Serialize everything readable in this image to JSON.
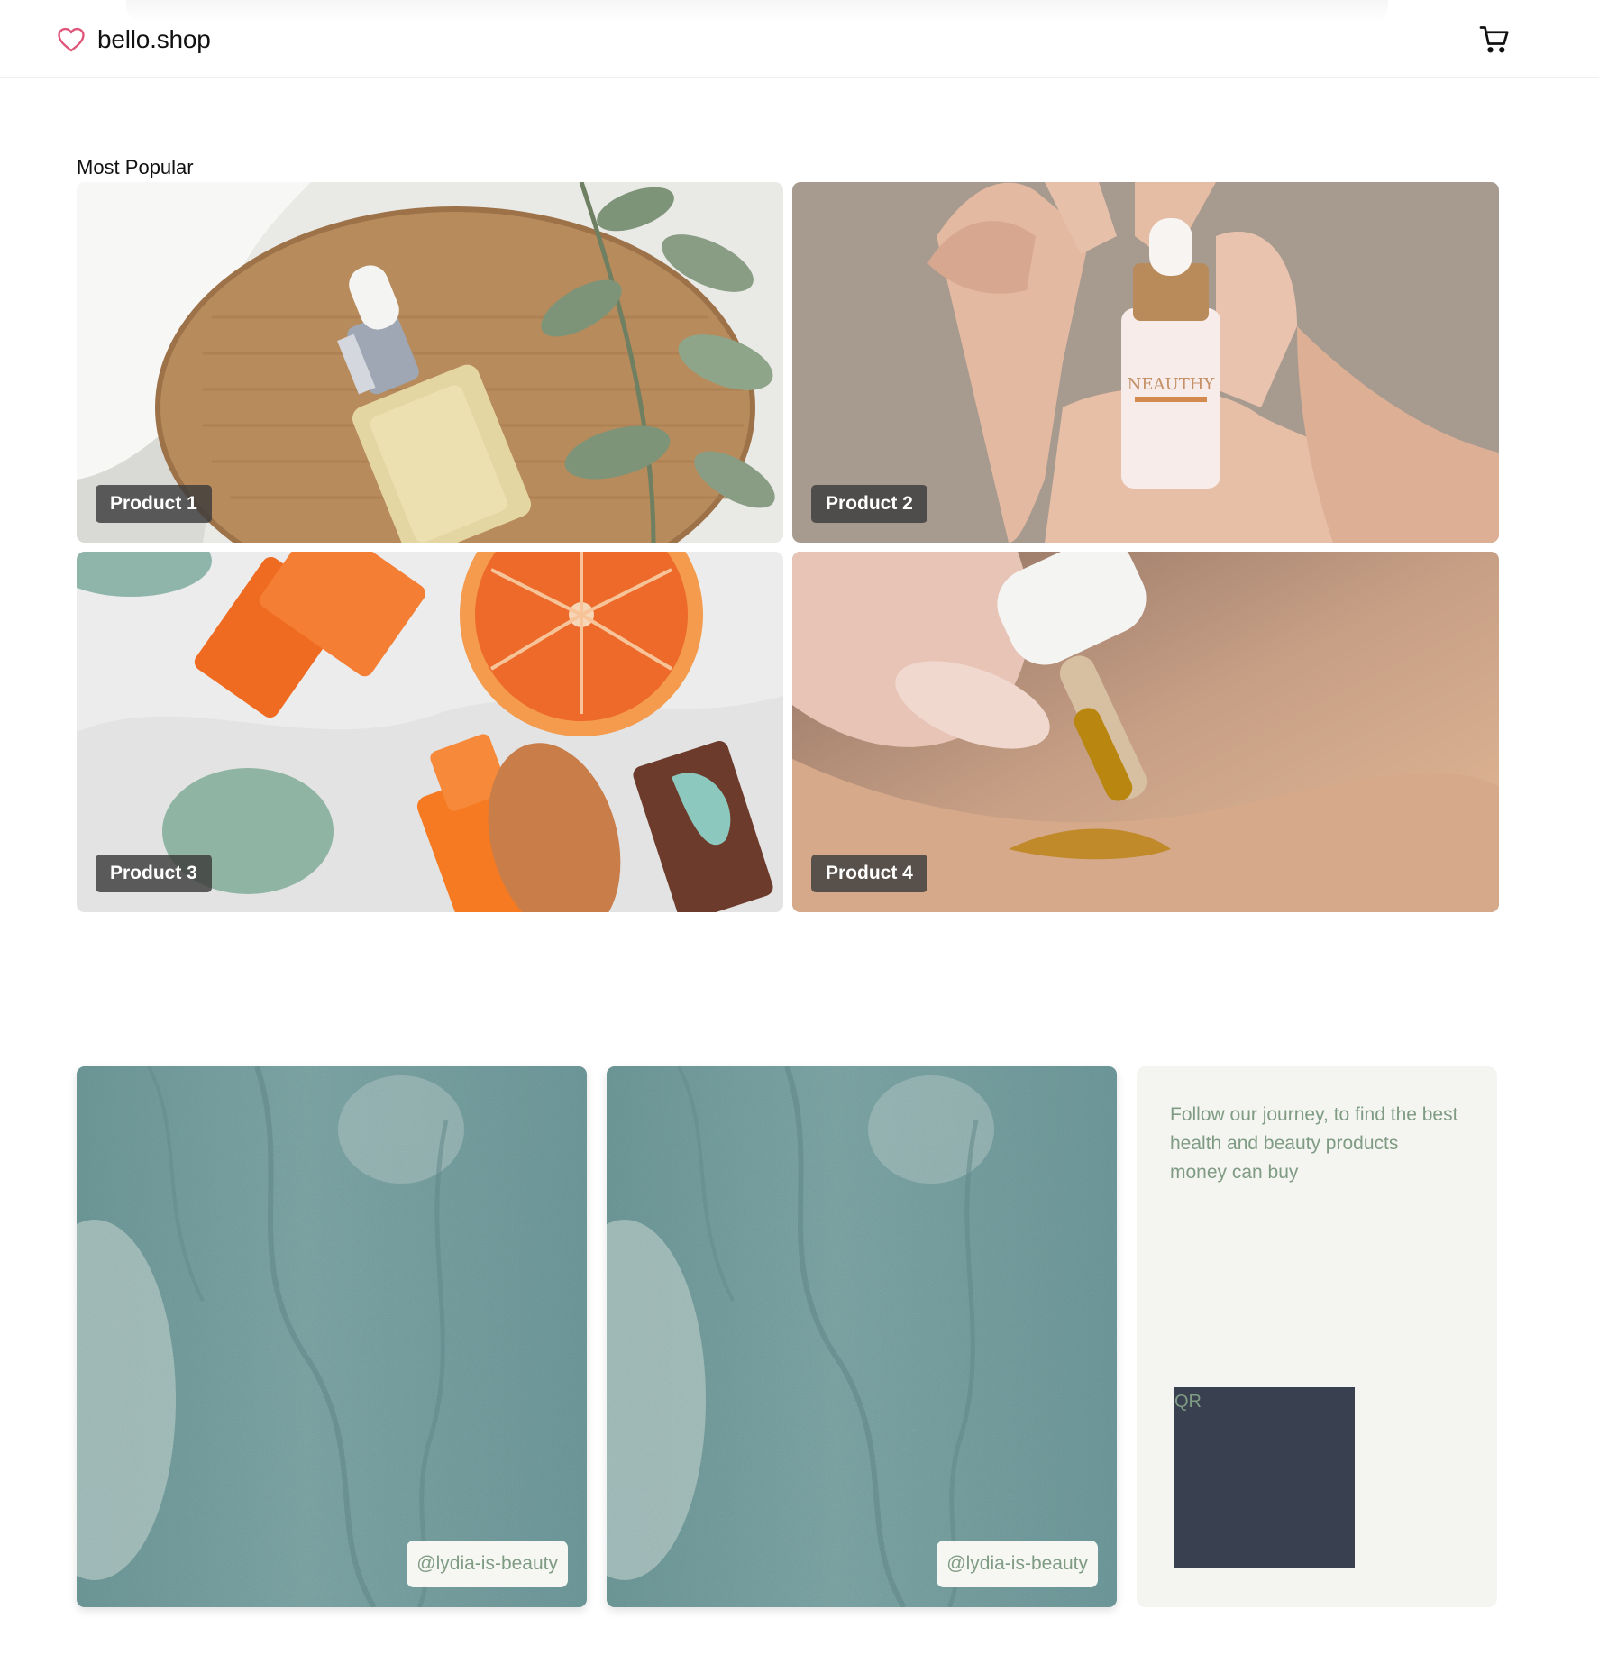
{
  "header": {
    "brand": "bello.shop",
    "logo_icon": "heart-icon",
    "cart_icon": "shopping-cart-icon",
    "accent_color": "#e0557a"
  },
  "popular": {
    "title": "Most Popular",
    "products": [
      {
        "label": "Product 1",
        "image": "serum-dropper-bottle-eucalyptus"
      },
      {
        "label": "Product 2",
        "image": "hand-holding-serum-bottle"
      },
      {
        "label": "Product 3",
        "image": "orange-bottles-with-citrus"
      },
      {
        "label": "Product 4",
        "image": "oil-dropper-on-skin"
      }
    ]
  },
  "social": {
    "posts": [
      {
        "handle": "@lydia-is-beauty",
        "image": "teal-textured-cream"
      },
      {
        "handle": "@lydia-is-beauty",
        "image": "teal-textured-cream"
      }
    ],
    "tagline": "Follow our journey, to find the best health and beauty products money can buy",
    "qr_label": "QR",
    "text_color": "#7f9b84",
    "qr_color": "#394050"
  }
}
